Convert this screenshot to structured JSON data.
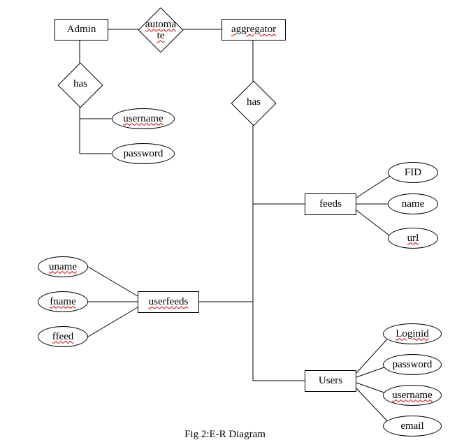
{
  "caption": "Fig 2:E-R Diagram",
  "entities": {
    "admin": {
      "label": "Admin",
      "spell": false
    },
    "aggregator": {
      "label": "aggregator",
      "spell": true
    },
    "feeds": {
      "label": "feeds",
      "spell": false
    },
    "userfeeds": {
      "label": "userfeeds",
      "spell": true
    },
    "users": {
      "label": "Users",
      "spell": false
    }
  },
  "relationships": {
    "automate": {
      "label": "automa\nte",
      "spell": true
    },
    "admin_has": {
      "label": "has",
      "spell": false
    },
    "agg_has": {
      "label": "has",
      "spell": false
    }
  },
  "attributes": {
    "admin_username": {
      "label": "username",
      "spell": true
    },
    "admin_password": {
      "label": "password",
      "spell": false
    },
    "feeds_fid": {
      "label": "FID",
      "spell": false
    },
    "feeds_name": {
      "label": "name",
      "spell": false
    },
    "feeds_url": {
      "label": "url",
      "spell": true
    },
    "uf_uname": {
      "label": "uname",
      "spell": true
    },
    "uf_fname": {
      "label": "fname",
      "spell": true
    },
    "uf_ffeed": {
      "label": "ffeed",
      "spell": true
    },
    "users_loginid": {
      "label": "Loginid",
      "spell": true
    },
    "users_password": {
      "label": "password",
      "spell": false
    },
    "users_username": {
      "label": "username",
      "spell": true
    },
    "users_email": {
      "label": "email",
      "spell": false
    }
  }
}
